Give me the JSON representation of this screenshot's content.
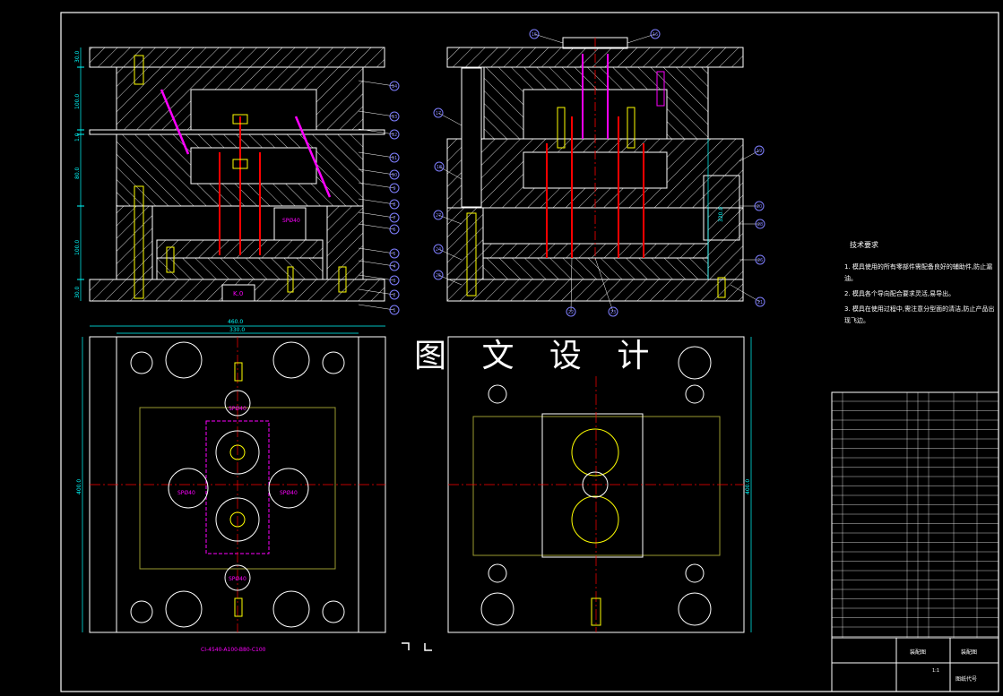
{
  "watermark": "图 文 设 计",
  "tech_requirements": {
    "title": "技术要求",
    "items": [
      "1. 模具使用的所有零部件需配备良好的辅助件,防止漏油。",
      "2. 模具各个导向配合要求灵活,易导出。",
      "3. 模具在使用过程中,需注意分型面的清洁,防止产品出现飞边。"
    ]
  },
  "dimensions": {
    "top_left_vertical": [
      "30.0",
      "100.0",
      "1.0",
      "80.0",
      "100.0",
      "30.0"
    ],
    "plan_width_outer": "460.0",
    "plan_width_inner": "330.0",
    "plan_height_left": "400.0",
    "plan_height_right": "400.0",
    "section_right_vertical": "320.0"
  },
  "labels": {
    "spacer_mark": "SPØ40",
    "bottom_mark": "K.0",
    "plan_marks": [
      "SPØ40",
      "SPØ40",
      "SPØ40",
      "SPØ40",
      "SPØ40"
    ],
    "mold_base_code": "CI-4540-A100-B80-C100"
  },
  "balloons_left": [
    "14",
    "13",
    "12",
    "11",
    "10",
    "9",
    "8",
    "7",
    "6",
    "5",
    "4",
    "3",
    "2",
    "1"
  ],
  "balloons_right": [
    "15",
    "16",
    "17",
    "18",
    "19",
    "20",
    "21",
    "22",
    "23",
    "24",
    "25",
    "26",
    "27",
    "28"
  ],
  "title_block": {
    "drawing_name": "装配图",
    "sheet_note": "装配图",
    "bottom_label": "图纸代号",
    "scale": "1:1"
  },
  "colors": {
    "background": "#000000",
    "line": "#ffffff",
    "hatch": "#ffffff",
    "center_line": "#ff0000",
    "dimension": "#00ffff",
    "balloon": "#7f7fff",
    "pin": "#ff00ff",
    "gear": "#ffff00",
    "olive": "#9a9a30"
  }
}
